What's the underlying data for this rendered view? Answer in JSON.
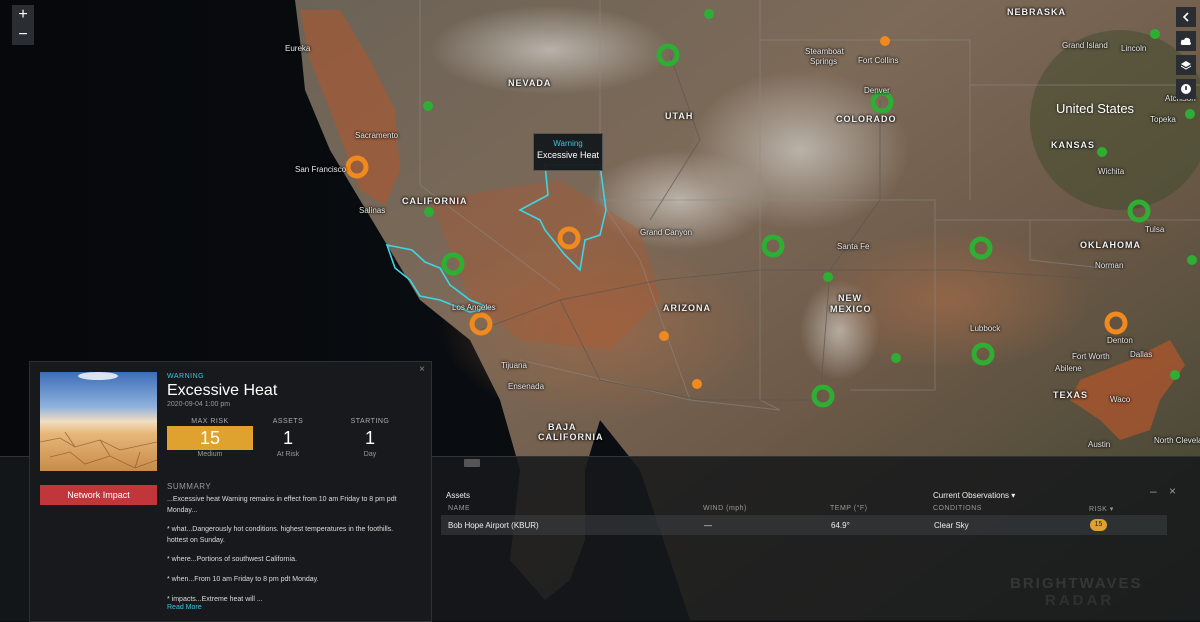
{
  "map": {
    "country_label": "United States",
    "state_labels": {
      "nebraska": "NEBRASKA",
      "nevada": "NEVADA",
      "utah": "UTAH",
      "colorado": "COLORADO",
      "kansas": "KANSAS",
      "california": "CALIFORNIA",
      "oklahoma": "OKLAHOMA",
      "arizona": "ARIZONA",
      "new_mexico_1": "NEW",
      "new_mexico_2": "MEXICO",
      "texas": "TEXAS",
      "baja_1": "BAJA",
      "baja_2": "CALIFORNIA",
      "baja_sur": "CALIFORNIA"
    },
    "city_labels": {
      "eureka": "Eureka",
      "grand_island": "Grand Island",
      "lincoln": "Lincoln",
      "steamboat": "Steamboat",
      "springs": "Springs",
      "fort_collins": "Fort Collins",
      "denver": "Denver",
      "sacramento": "Sacramento",
      "san_francisco": "San Francisco",
      "salinas": "Salinas",
      "topeka": "Topeka",
      "wichita": "Wichita",
      "tulsa": "Tulsa",
      "norman": "Norman",
      "santa_fe": "Santa Fe",
      "lubbock": "Lubbock",
      "abilene": "Abilene",
      "fort_worth": "Fort Worth",
      "dallas": "Dallas",
      "denton": "Denton",
      "waco": "Waco",
      "austin": "Austin",
      "north_cleveland": "North Cleveland",
      "tijuana": "Tijuana",
      "ensenada": "Ensenada",
      "los_angeles": "Los Angeles",
      "grand_canyon": "Grand Canyon",
      "atchison": "Atchison"
    },
    "zoom_in_label": "+",
    "zoom_out_label": "−",
    "marker_colors": {
      "ok": "#2fae34",
      "warn": "#f08a1e",
      "zone": "#3fd4e6",
      "heat": "#b5552b"
    },
    "tooltip": {
      "severity": "Warning",
      "event": "Excessive Heat"
    }
  },
  "alert_panel": {
    "severity": "WARNING",
    "title": "Excessive Heat",
    "date": "2020-09-04 1:00 pm",
    "stats": [
      {
        "head": "MAX RISK",
        "value": "15",
        "sub": "Medium"
      },
      {
        "head": "ASSETS",
        "value": "1",
        "sub": "At Risk"
      },
      {
        "head": "STARTING",
        "value": "1",
        "sub": "Day"
      }
    ],
    "network_impact_label": "Network Impact",
    "summary_head": "SUMMARY",
    "summary": [
      "...Excessive heat Warning remains in effect from 10 am Friday to 8 pm pdt Monday...",
      "* what...Dangerously hot conditions. highest temperatures in the foothills. hottest on Sunday.",
      "* where...Portions of southwest California.",
      "* when...From 10 am Friday to 8 pm pdt Monday.",
      "* impacts...Extreme heat will ..."
    ],
    "read_more": "Read More",
    "close": "×"
  },
  "assets_panel": {
    "title": "Assets",
    "observations_label": "Current Observations ▾",
    "columns": {
      "name": "NAME",
      "wind": "WIND (mph)",
      "temp": "TEMP (°F)",
      "conditions": "CONDITIONS",
      "risk": "RISK ▾"
    },
    "rows": [
      {
        "name": "Bob Hope Airport (KBUR)",
        "wind": "—",
        "temp": "64.9°",
        "conditions": "Clear Sky",
        "risk": "15"
      }
    ],
    "minimize": "–",
    "close": "×"
  },
  "watermark": {
    "line1": "BRIGHTWAVES",
    "line2": "RADAR"
  }
}
